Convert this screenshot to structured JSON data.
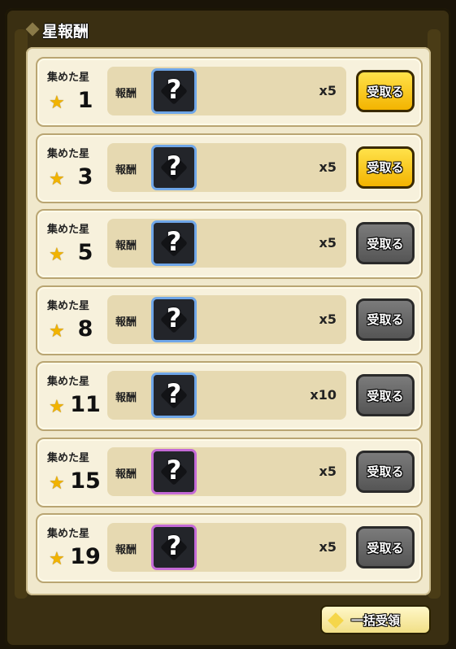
{
  "header": {
    "title": "星報酬"
  },
  "labels": {
    "collected": "集めた星",
    "reward": "報酬",
    "claim": "受取る",
    "question": "?"
  },
  "rows": [
    {
      "stars": "1",
      "qty": "x5",
      "claim_state": "active",
      "frame": "blue"
    },
    {
      "stars": "3",
      "qty": "x5",
      "claim_state": "active",
      "frame": "blue"
    },
    {
      "stars": "5",
      "qty": "x5",
      "claim_state": "disabled",
      "frame": "blue"
    },
    {
      "stars": "8",
      "qty": "x5",
      "claim_state": "disabled",
      "frame": "blue"
    },
    {
      "stars": "11",
      "qty": "x10",
      "claim_state": "disabled",
      "frame": "blue"
    },
    {
      "stars": "15",
      "qty": "x5",
      "claim_state": "disabled",
      "frame": "purple"
    },
    {
      "stars": "19",
      "qty": "x5",
      "claim_state": "disabled",
      "frame": "purple"
    }
  ],
  "footer": {
    "bulk_claim": "一括受領"
  },
  "colors": {
    "accent_yellow": "#f3b400",
    "frame_blue": "#6fa6e8",
    "frame_purple": "#c46ad6",
    "star": "#f1b300"
  },
  "icons": {
    "star": "star-icon",
    "item": "mystery-item-icon"
  }
}
